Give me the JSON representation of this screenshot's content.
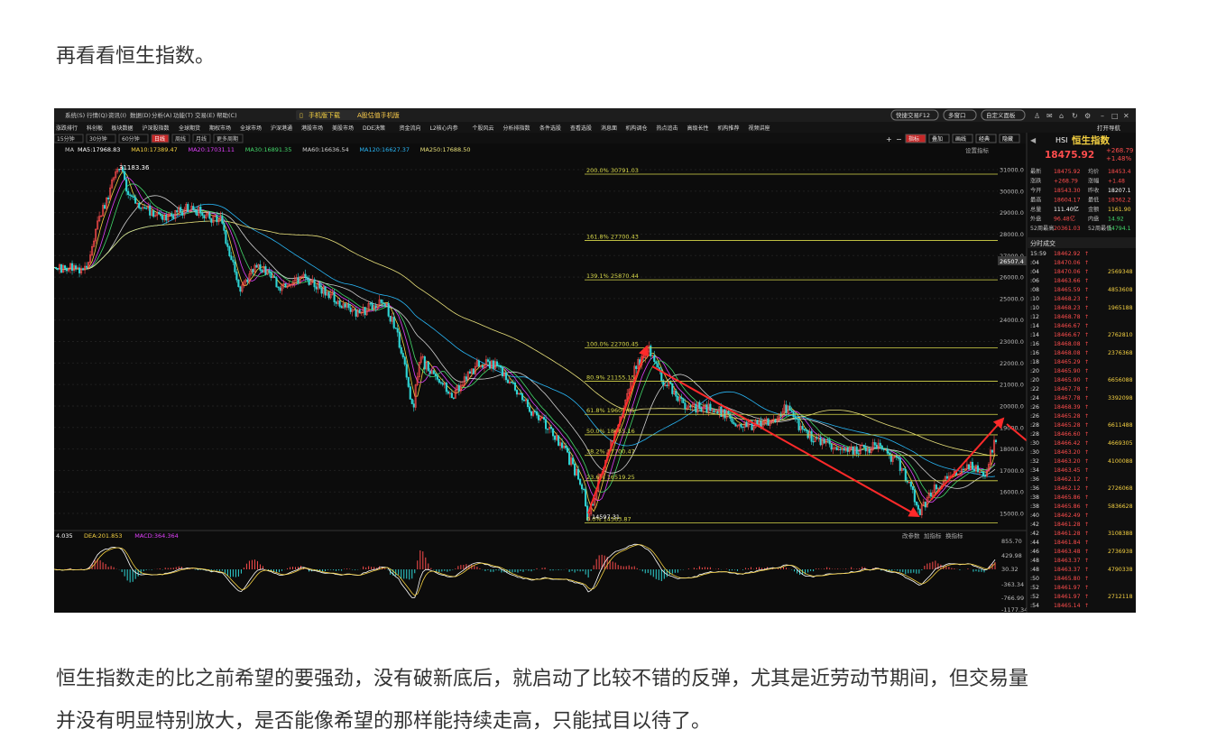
{
  "article": {
    "intro": "再看看恒生指数。",
    "outro_line1": "恒生指数走的比之前希望的要强劲，没有破新底后，就启动了比较不错的反弹，尤其是近劳动节期间，但交易量",
    "outro_line2": "并没有明显特别放大，是否能像希望的那样能持续走高，只能拭目以待了。"
  },
  "app": {
    "menu": [
      "系统(S)",
      "行情(Q)",
      "资讯(I)",
      "数据(D)",
      "分析(A)",
      "功能(T)",
      "交易(E)",
      "帮助(C)"
    ],
    "mobile_download": "手机版下载",
    "promo": "A股估值手机版",
    "hotkey": "快捷交易F12",
    "multi_window": "多窗口",
    "custom_layout": "自定义面板",
    "toolbar2": [
      "涨跌排行",
      "科创板",
      "板块数据",
      "沪深股指数",
      "全球期货",
      "期权市场",
      "全球市场",
      "沪深港通",
      "港股市场",
      "美股市场",
      "DDE决策",
      "资金流向",
      "L2核心内参",
      "个股风云",
      "分析排指数",
      "条件选股",
      "查看选股",
      "消息面",
      "机构调仓",
      "热点追击",
      "高级长性",
      "机构推荐",
      "视频讲座"
    ],
    "periods": [
      "15分钟",
      "30分钟",
      "60分钟",
      "日线",
      "周线",
      "月线",
      "更多周期"
    ],
    "active_period": "日线",
    "right_tools": [
      "指标",
      "叠加",
      "画线",
      "经典",
      "隐藏"
    ],
    "indicator_btn": "设置指标"
  },
  "ma_legend": {
    "prefix": "MA",
    "items": [
      {
        "label": "MA5:17968.83",
        "color": "#ffffff"
      },
      {
        "label": "MA10:17389.47",
        "color": "#f5d142"
      },
      {
        "label": "MA20:17031.11",
        "color": "#e040fb"
      },
      {
        "label": "MA30:16891.35",
        "color": "#43d96b"
      },
      {
        "label": "MA60:16636.54",
        "color": "#d0d0d0"
      },
      {
        "label": "MA120:16627.37",
        "color": "#29b6f6"
      },
      {
        "label": "MA250:17688.50",
        "color": "#e8e07a"
      }
    ]
  },
  "price_axis": {
    "ticks": [
      "31000.0",
      "30000.0",
      "29000.0",
      "28000.0",
      "27000.0",
      "26000.0",
      "25000.0",
      "24000.0",
      "23000.0",
      "22000.0",
      "21000.0",
      "20000.0",
      "19000.0",
      "18000.0",
      "17000.0",
      "16000.0",
      "15000.0"
    ],
    "crosshair_label": "26507.4"
  },
  "chart_labels": {
    "peak": "31183.36",
    "low": "14597.31",
    "low_b": "14563.87"
  },
  "fib_levels": [
    {
      "label": "200.0% 30791.03",
      "value": 30791.03
    },
    {
      "label": "161.8% 27700.43",
      "value": 27700.43
    },
    {
      "label": "139.1% 25870.44",
      "value": 25870.44
    },
    {
      "label": "100.0% 22700.45",
      "value": 22700.45
    },
    {
      "label": "80.9% 21155.15",
      "value": 21155.15
    },
    {
      "label": "61.8% 19609.85",
      "value": 19609.85
    },
    {
      "label": "50.0% 18655.16",
      "value": 18655.16
    },
    {
      "label": "38.2% 17700.47",
      "value": 17700.47
    },
    {
      "label": "23.6% 16519.25",
      "value": 16519.25
    },
    {
      "label": "0.0% 14563.87",
      "value": 14563.87
    }
  ],
  "macd": {
    "legend": [
      {
        "label": "4.035",
        "color": "#ffffff"
      },
      {
        "label": "DEA:201.853",
        "color": "#f5d142"
      },
      {
        "label": "MACD:364.364",
        "color": "#e040fb"
      }
    ],
    "ticks": [
      "855.70",
      "429.98",
      "30.32",
      "-363.34",
      "-766.99",
      "-1177.34"
    ],
    "tabs": [
      "改参数",
      "加指标",
      "换指标"
    ]
  },
  "quote_panel": {
    "code": "HSI",
    "name": "恒生指数",
    "price": "18475.92",
    "change": "+268.79",
    "change_pct": "+1.48%",
    "rows": [
      {
        "l1": "最新",
        "v1": "18475.92",
        "l2": "均价",
        "v2": "18453.4",
        "c1": "#ff4d4d",
        "c2": "#ff4d4d"
      },
      {
        "l1": "涨跌",
        "v1": "+268.79",
        "l2": "涨幅",
        "v2": "+1.48",
        "c1": "#ff4d4d",
        "c2": "#ff4d4d"
      },
      {
        "l1": "今开",
        "v1": "18543.30",
        "l2": "昨收",
        "v2": "18207.1",
        "c1": "#ff4d4d",
        "c2": "#ffffff"
      },
      {
        "l1": "最高",
        "v1": "18604.17",
        "l2": "最低",
        "v2": "18362.2",
        "c1": "#ff4d4d",
        "c2": "#ff4d4d"
      },
      {
        "l1": "总量",
        "v1": "111.40亿",
        "l2": "金额",
        "v2": "1161.90",
        "c1": "#ffffff",
        "c2": "#f5d142"
      },
      {
        "l1": "外盘",
        "v1": "96.48亿",
        "l2": "内盘",
        "v2": "14.92",
        "c1": "#ff4d4d",
        "c2": "#43d96b"
      },
      {
        "l1": "52周最高",
        "v1": "20361.03",
        "l2": "52周最低",
        "v2": "14794.1",
        "c1": "#ff4d4d",
        "c2": "#43d96b"
      }
    ],
    "ticks_title": "分时成交",
    "ticks_rows": [
      {
        "t": "15:59",
        "p": "18462.92",
        "v": ""
      },
      {
        "t": ":04",
        "p": "18470.06",
        "v": ""
      },
      {
        "t": ":04",
        "p": "18470.06",
        "v": "2569348"
      },
      {
        "t": ":06",
        "p": "18463.66",
        "v": ""
      },
      {
        "t": ":08",
        "p": "18465.59",
        "v": "4853608"
      },
      {
        "t": ":10",
        "p": "18468.23",
        "v": ""
      },
      {
        "t": ":10",
        "p": "18468.23",
        "v": "1965188"
      },
      {
        "t": ":12",
        "p": "18468.78",
        "v": ""
      },
      {
        "t": ":14",
        "p": "18466.67",
        "v": ""
      },
      {
        "t": ":14",
        "p": "18466.67",
        "v": "2762810"
      },
      {
        "t": ":16",
        "p": "18468.08",
        "v": ""
      },
      {
        "t": ":16",
        "p": "18468.08",
        "v": "2376368"
      },
      {
        "t": ":18",
        "p": "18465.29",
        "v": ""
      },
      {
        "t": ":20",
        "p": "18465.90",
        "v": ""
      },
      {
        "t": ":20",
        "p": "18465.90",
        "v": "6656088"
      },
      {
        "t": ":22",
        "p": "18467.78",
        "v": ""
      },
      {
        "t": ":24",
        "p": "18467.78",
        "v": "3392098"
      },
      {
        "t": ":26",
        "p": "18468.39",
        "v": ""
      },
      {
        "t": ":26",
        "p": "18465.28",
        "v": ""
      },
      {
        "t": ":28",
        "p": "18465.28",
        "v": "6611488"
      },
      {
        "t": ":28",
        "p": "18466.60",
        "v": ""
      },
      {
        "t": ":30",
        "p": "18466.42",
        "v": "4669305"
      },
      {
        "t": ":30",
        "p": "18463.20",
        "v": ""
      },
      {
        "t": ":32",
        "p": "18463.20",
        "v": "4100088"
      },
      {
        "t": ":34",
        "p": "18463.45",
        "v": ""
      },
      {
        "t": ":36",
        "p": "18462.12",
        "v": ""
      },
      {
        "t": ":36",
        "p": "18462.12",
        "v": "2726068"
      },
      {
        "t": ":38",
        "p": "18465.86",
        "v": ""
      },
      {
        "t": ":38",
        "p": "18465.86",
        "v": "5836628"
      },
      {
        "t": ":40",
        "p": "18462.49",
        "v": ""
      },
      {
        "t": ":42",
        "p": "18461.28",
        "v": ""
      },
      {
        "t": ":42",
        "p": "18461.28",
        "v": "3108388"
      },
      {
        "t": ":44",
        "p": "18461.84",
        "v": ""
      },
      {
        "t": ":46",
        "p": "18463.48",
        "v": "2736938"
      },
      {
        "t": ":48",
        "p": "18463.37",
        "v": ""
      },
      {
        "t": ":48",
        "p": "18463.37",
        "v": "4790338"
      },
      {
        "t": ":50",
        "p": "18465.80",
        "v": ""
      },
      {
        "t": ":52",
        "p": "18461.97",
        "v": ""
      },
      {
        "t": ":52",
        "p": "18461.97",
        "v": "2712118"
      },
      {
        "t": ":54",
        "p": "18465.14",
        "v": ""
      }
    ]
  },
  "colors": {
    "up": "#ff4d4d",
    "down": "#2fd6d6",
    "fib": "#d8d84a",
    "arrow": "#ff2a2a",
    "bg": "#0c0c0c"
  }
}
